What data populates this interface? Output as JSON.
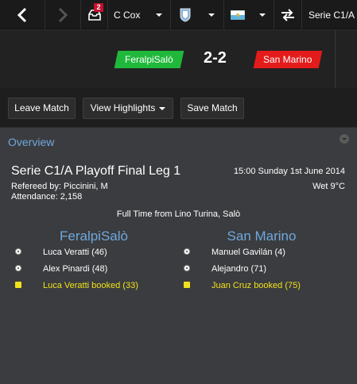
{
  "topbar": {
    "inbox_badge": "2",
    "manager": "C Cox",
    "competition": "Serie C1/A"
  },
  "match": {
    "home_team": "FeralpiSalò",
    "away_team": "San Marino",
    "score": "2-2",
    "home_color": "#1fb83b",
    "away_color": "#e31b1b"
  },
  "actions": {
    "leave": "Leave Match",
    "highlights": "View Highlights",
    "save": "Save Match"
  },
  "overview": {
    "title": "Overview",
    "competition": "Serie C1/A Playoff Final Leg 1",
    "datetime": "15:00 Sunday 1st June 2014",
    "referee": "Refereed by: Piccinini, M",
    "weather": "Wet 9°C",
    "attendance": "Attendance: 2,158",
    "result_line": "Full Time from Lino Turina, Salò",
    "home_events": [
      {
        "type": "goal",
        "text": "Luca Veratti (46)"
      },
      {
        "type": "goal",
        "text": "Alex Pinardi (48)"
      },
      {
        "type": "booking",
        "text": "Luca Veratti booked (33)"
      }
    ],
    "away_events": [
      {
        "type": "goal",
        "text": "Manuel Gavilán (4)"
      },
      {
        "type": "goal",
        "text": "Alejandro (71)"
      },
      {
        "type": "booking",
        "text": "Juan Cruz booked (75)"
      }
    ]
  },
  "colors": {
    "accent_blue": "#6fa8dc",
    "booking_yellow": "#f2e21c"
  }
}
